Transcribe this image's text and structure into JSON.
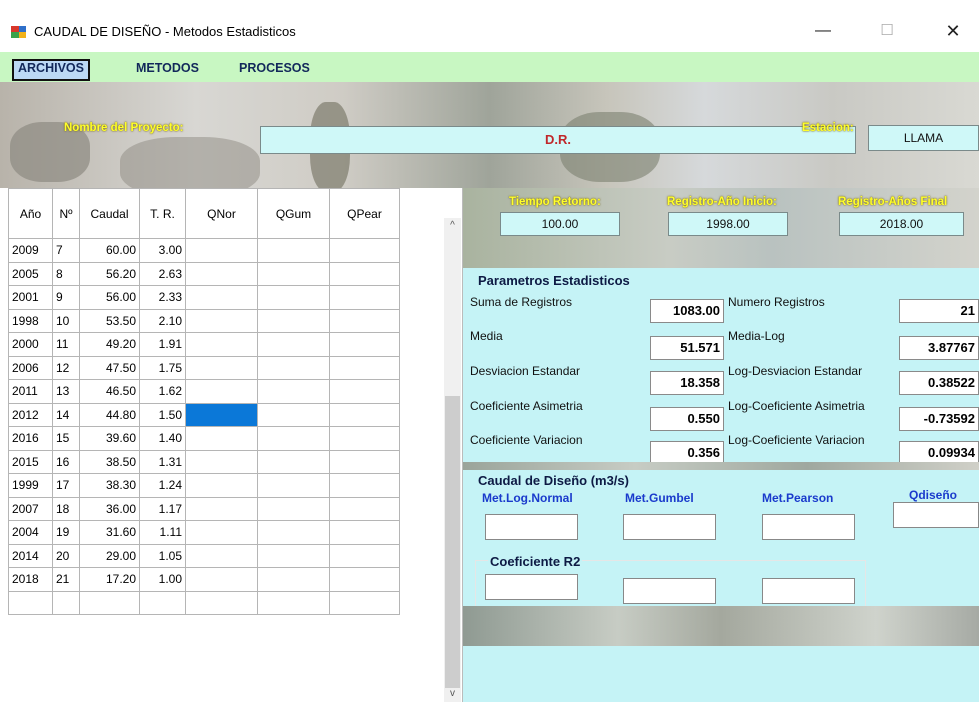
{
  "window": {
    "title": "CAUDAL DE DISEÑO - Metodos Estadisticos",
    "minimize": "—",
    "maximize": "☐",
    "close": "✕"
  },
  "menu": {
    "items": [
      "ARCHIVOS",
      "METODOS",
      "PROCESOS"
    ]
  },
  "project": {
    "name_label": "Nombre del Proyecto:",
    "name_value": "D.R.",
    "station_label": "Estacion:",
    "station_value": "LLAMA",
    "return_label": "Tiempo Retorno:",
    "return_value": "100.00",
    "start_label": "Registro-Año Inicio:",
    "start_value": "1998.00",
    "final_label": "Registro-Años Final",
    "final_value": "2018.00"
  },
  "grid": {
    "columns": [
      "Año",
      "Nº",
      "Caudal",
      "T. R.",
      "QNor",
      "QGum",
      "QPear"
    ],
    "rows": [
      [
        "2009",
        "7",
        "60.00",
        "3.00"
      ],
      [
        "2005",
        "8",
        "56.20",
        "2.63"
      ],
      [
        "2001",
        "9",
        "56.00",
        "2.33"
      ],
      [
        "1998",
        "10",
        "53.50",
        "2.10"
      ],
      [
        "2000",
        "11",
        "49.20",
        "1.91"
      ],
      [
        "2006",
        "12",
        "47.50",
        "1.75"
      ],
      [
        "2011",
        "13",
        "46.50",
        "1.62"
      ],
      [
        "2012",
        "14",
        "44.80",
        "1.50"
      ],
      [
        "2016",
        "15",
        "39.60",
        "1.40"
      ],
      [
        "2015",
        "16",
        "38.50",
        "1.31"
      ],
      [
        "1999",
        "17",
        "38.30",
        "1.24"
      ],
      [
        "2007",
        "18",
        "36.00",
        "1.17"
      ],
      [
        "2004",
        "19",
        "31.60",
        "1.11"
      ],
      [
        "2014",
        "20",
        "29.00",
        "1.05"
      ],
      [
        "2018",
        "21",
        "17.20",
        "1.00"
      ]
    ]
  },
  "stats": {
    "title": "Parametros Estadisticos",
    "suma_label": "Suma de Registros",
    "suma_value": "1083.00",
    "num_label": "Numero Registros",
    "num_value": "21",
    "media_label": "Media",
    "media_value": "51.571",
    "medialog_label": "Media-Log",
    "medialog_value": "3.87767",
    "desv_label": "Desviacion Estandar",
    "desv_value": "18.358",
    "logdesv_label": "Log-Desviacion Estandar",
    "logdesv_value": "0.38522",
    "asim_label": "Coeficiente Asimetria",
    "asim_value": "0.550",
    "logasim_label": "Log-Coeficiente Asimetria",
    "logasim_value": "-0.73592",
    "var_label": "Coeficiente Variacion",
    "var_value": "0.356",
    "logvar_label": "Log-Coeficiente Variacion",
    "logvar_value": "0.09934"
  },
  "design": {
    "title": "Caudal de Diseño (m3/s)",
    "lognormal": "Met.Log.Normal",
    "gumbel": "Met.Gumbel",
    "pearson": "Met.Pearson",
    "qdiseno": "Qdiseño",
    "r2_title": "Coeficiente R2"
  },
  "colors": {
    "menu_bg": "#c8f7c2",
    "panel_bg": "#c5f3f6",
    "selected_cell": "#0b78d8",
    "label_yellow": "#ffff2a"
  }
}
